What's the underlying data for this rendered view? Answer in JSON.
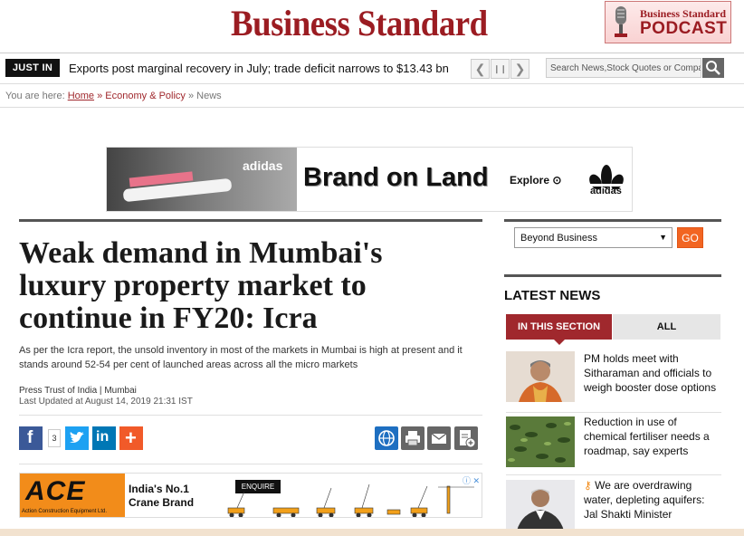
{
  "header": {
    "logo_text": "Business Standard",
    "podcast_line1": "Business Standard",
    "podcast_line2": "PODCAST"
  },
  "ticker": {
    "label": "JUST IN",
    "headline": "Exports post marginal recovery in July; trade deficit narrows to $13.43 bn",
    "prev": "❮",
    "pause": "❙❙",
    "next": "❯"
  },
  "search": {
    "placeholder": "Search News,Stock Quotes or Companies"
  },
  "breadcrumb": {
    "prefix": "You are here: ",
    "home": "Home",
    "sep1": " » ",
    "section": "Economy & Policy",
    "sep2": " » ",
    "current": "News"
  },
  "banner_ad": {
    "brand_mark": "adidas",
    "headline": "Brand on Land",
    "cta": "Explore",
    "cta_icon": "⊙",
    "logo_word": "adidas"
  },
  "article": {
    "title": "Weak demand in Mumbai's luxury property market to continue in FY20: Icra",
    "summary": "As per the Icra report, the unsold inventory in most of the markets in Mumbai is high at present and it stands around 52-54 per cent of launched areas across all the micro markets",
    "source": "Press Trust of India",
    "meta_sep": " | ",
    "location": "Mumbai",
    "updated": "Last Updated at August 14, 2019 21:31 IST",
    "share_count": "3"
  },
  "social": {
    "facebook": "f",
    "twitter_alt": "twitter",
    "linkedin": "in",
    "more": "+"
  },
  "ace_ad": {
    "logo": "ACE",
    "company": "Action Construction Equipment Ltd.",
    "tagline1": "India's No.1",
    "tagline2": "Crane Brand",
    "enquire": "ENQUIRE"
  },
  "sidebar": {
    "select_value": "Beyond Business",
    "go_label": "GO",
    "latest_title": "LATEST NEWS",
    "tab_section": "IN THIS SECTION",
    "tab_all": "ALL",
    "news": [
      {
        "text": "PM holds meet with Sitharaman and officials to weigh booster dose options"
      },
      {
        "text": "Reduction in use of chemical fertiliser needs a roadmap, say experts"
      },
      {
        "text": "We are overdrawing water, depleting aquifers: Jal Shakti Minister"
      }
    ]
  },
  "colors": {
    "brand": "#9b1c22",
    "tab_active": "#a0282d",
    "go_button": "#f26522"
  }
}
